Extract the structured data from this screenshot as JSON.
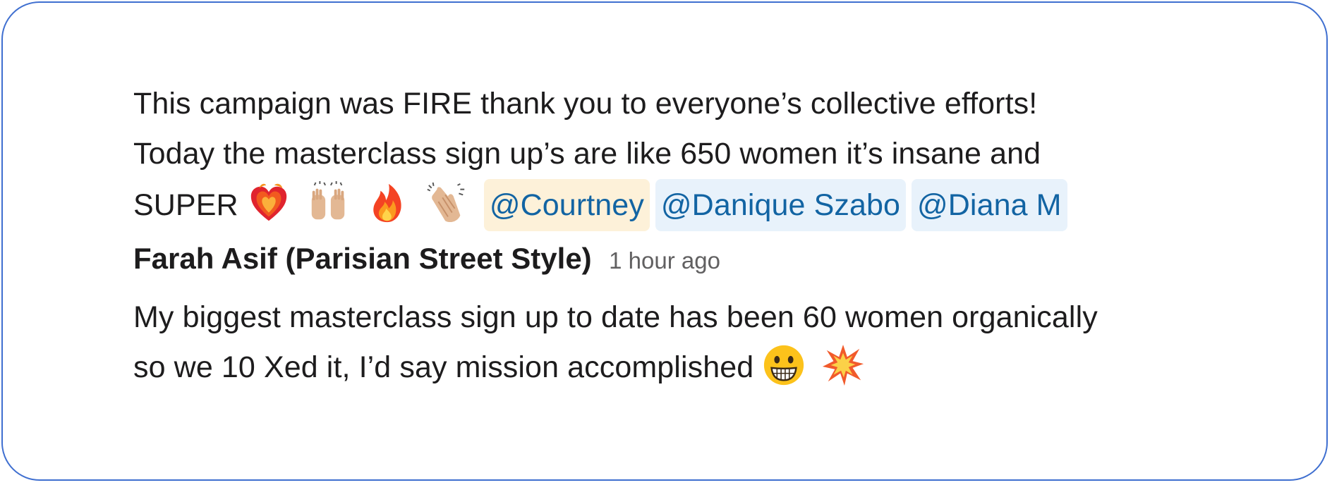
{
  "message1": {
    "line1": "This campaign was FIRE thank you to everyone’s collective efforts!",
    "line2": "Today the masterclass sign up’s are like 650 women it’s insane and",
    "line3_text": "SUPER",
    "emojis": [
      "heart-on-fire-icon",
      "raising-hands-icon",
      "fire-icon",
      "clapping-hands-icon"
    ],
    "mentions": [
      {
        "label": "@Courtney",
        "highlight": "#fdf1d9"
      },
      {
        "label": "@Danique Szabo",
        "highlight": "#e8f2fb"
      },
      {
        "label": "@Diana M",
        "highlight": "#e8f2fb"
      }
    ]
  },
  "message2": {
    "author": "Farah Asif (Parisian Street Style)",
    "timestamp": "1 hour ago",
    "line1": "My biggest masterclass sign up to date has been 60 women organically",
    "line2": "so we 10 Xed it, I’d say mission accomplished",
    "emojis": [
      "grinning-face-icon",
      "collision-icon"
    ]
  },
  "colors": {
    "border": "#3f6fd0",
    "mention_text": "#1264a3",
    "text": "#1d1c1d",
    "timestamp": "#616061"
  }
}
